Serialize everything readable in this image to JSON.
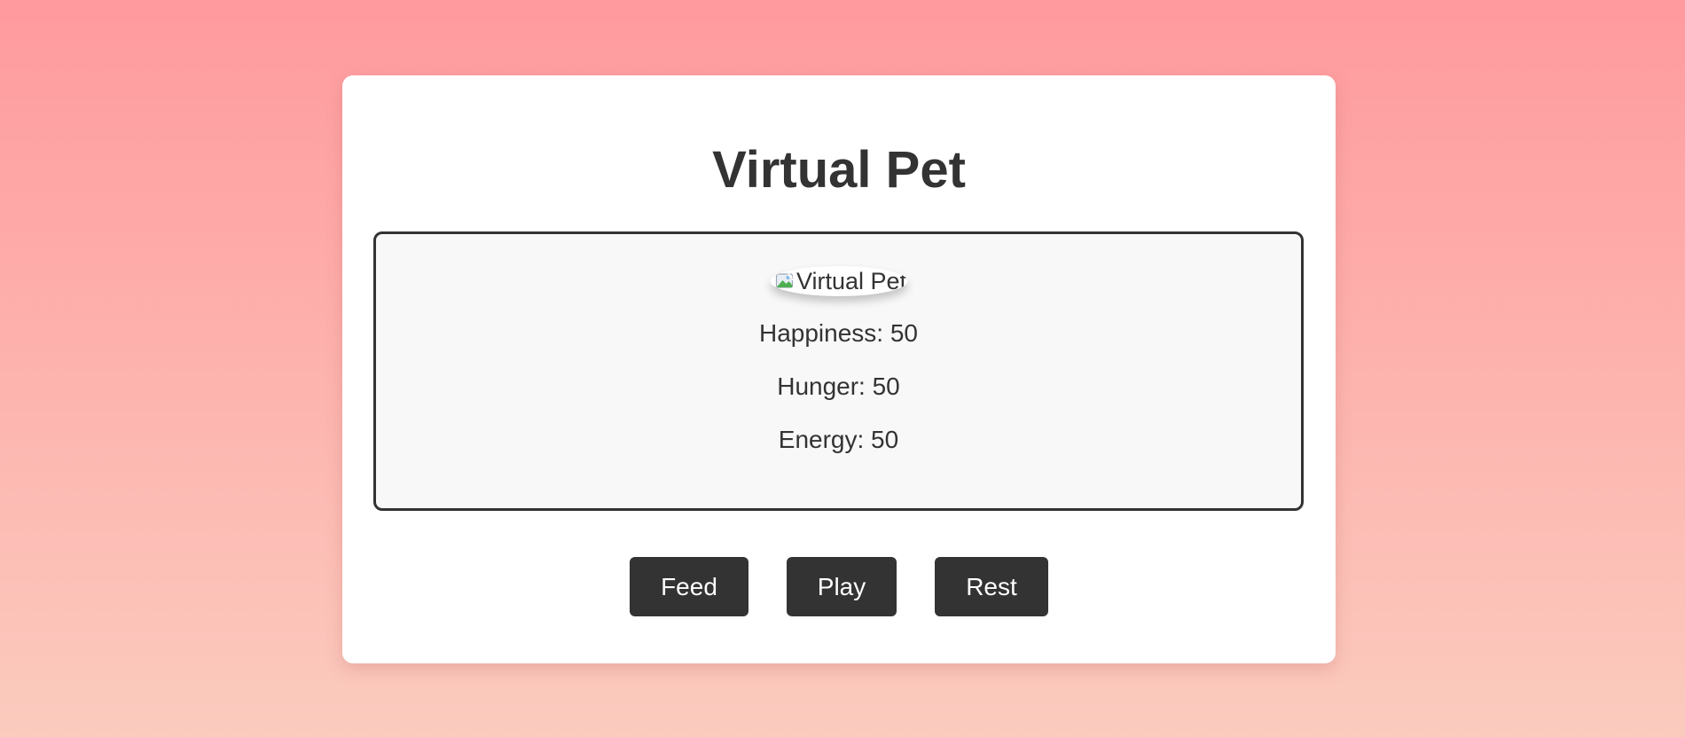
{
  "app": {
    "title": "Virtual Pet"
  },
  "pet": {
    "image_alt": "Virtual Pet",
    "stats": {
      "happiness": "Happiness: 50",
      "hunger": "Hunger: 50",
      "energy": "Energy: 50"
    }
  },
  "actions": {
    "feed_label": "Feed",
    "play_label": "Play",
    "rest_label": "Rest"
  },
  "colors": {
    "background_top": "#ff9a9e",
    "background_bottom": "#fbcbbe",
    "card": "#ffffff",
    "panel": "#f8f8f8",
    "text": "#333333",
    "button": "#333333",
    "button_text": "#ffffff"
  },
  "icons": {
    "pet_image": "broken-image-icon"
  }
}
